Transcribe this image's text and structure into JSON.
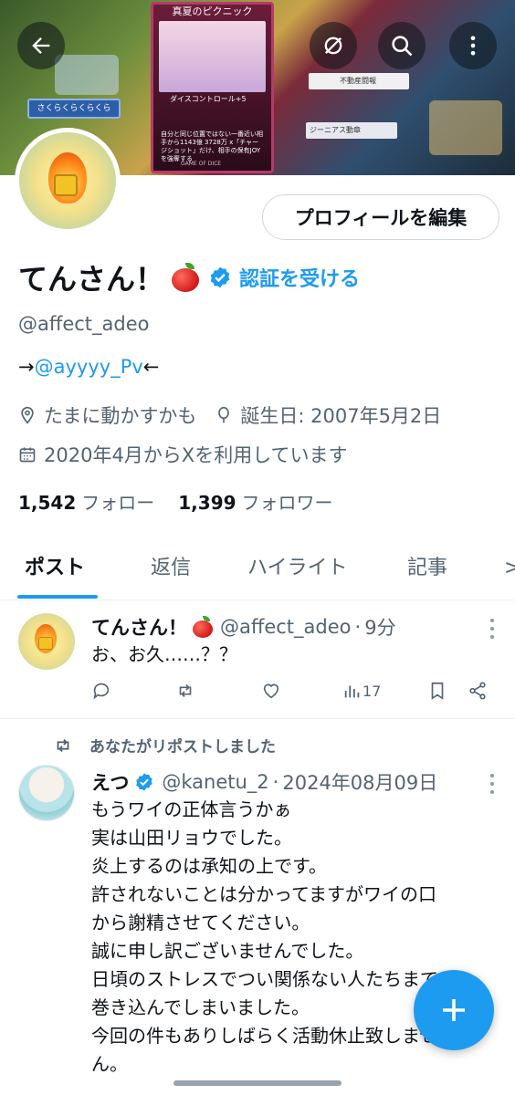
{
  "header": {
    "banner": {
      "card_title": "真夏のピクニック",
      "card_sub": "ダイスコントロール+5",
      "card_desc": "自分と同じ位置ではない一番近い相手から1143億 3728万 x「チャージショット」だけ、相手の保有JOYを強奪する",
      "card_foot": "GAME OF DICE",
      "left_panel": "さくらくらくらくら",
      "right_panel_1": "不動産闘報",
      "right_panel_2": "ジーニアス動章"
    },
    "back_icon": "arrow-left-icon",
    "mute_icon": "eye-slash-icon",
    "search_icon": "search-icon",
    "more_icon": "more-vertical-icon"
  },
  "profile": {
    "edit_button": "プロフィールを編集",
    "name": "てんさん！",
    "get_verified": "認証を受ける",
    "handle": "@affect_adeo",
    "bio_prefix": "→",
    "bio_mention": "@ayyyy_Pv",
    "bio_suffix": "←",
    "location": "たまに動かすかも",
    "birthday": "誕生日: 2007年5月2日",
    "joined": "2020年4月からXを利用しています",
    "following_count": "1,542",
    "following_label": "フォロー",
    "followers_count": "1,399",
    "followers_label": "フォロワー"
  },
  "tabs": [
    {
      "label": "ポスト",
      "active": true
    },
    {
      "label": "返信"
    },
    {
      "label": "ハイライト"
    },
    {
      "label": "記事"
    },
    {
      "label": ">"
    }
  ],
  "posts": [
    {
      "name": "てんさん！",
      "handle": "@affect_adeo",
      "time": "9分",
      "text": "お、お久……？？",
      "views": "17"
    },
    {
      "repost_label": "あなたがリポストしました",
      "name": "えつ",
      "handle": "@kanetu_2",
      "time": "2024年08月09日",
      "text": "もうワイの正体言うかぁ\n実は山田リョウでした。\n炎上するのは承知の上です。\n許されないことは分かってますがワイの口\nから謝精させてください。\n誠に申し訳ございませんでした。\n日頃のストレスでつい関係ない人たちまで\n巻き込んでしまいました。\n今回の件もありしばらく活動休止致しませ\nん。"
    }
  ],
  "colors": {
    "accent": "#1d9bf0",
    "text_primary": "#0f1419",
    "text_secondary": "#536471"
  }
}
